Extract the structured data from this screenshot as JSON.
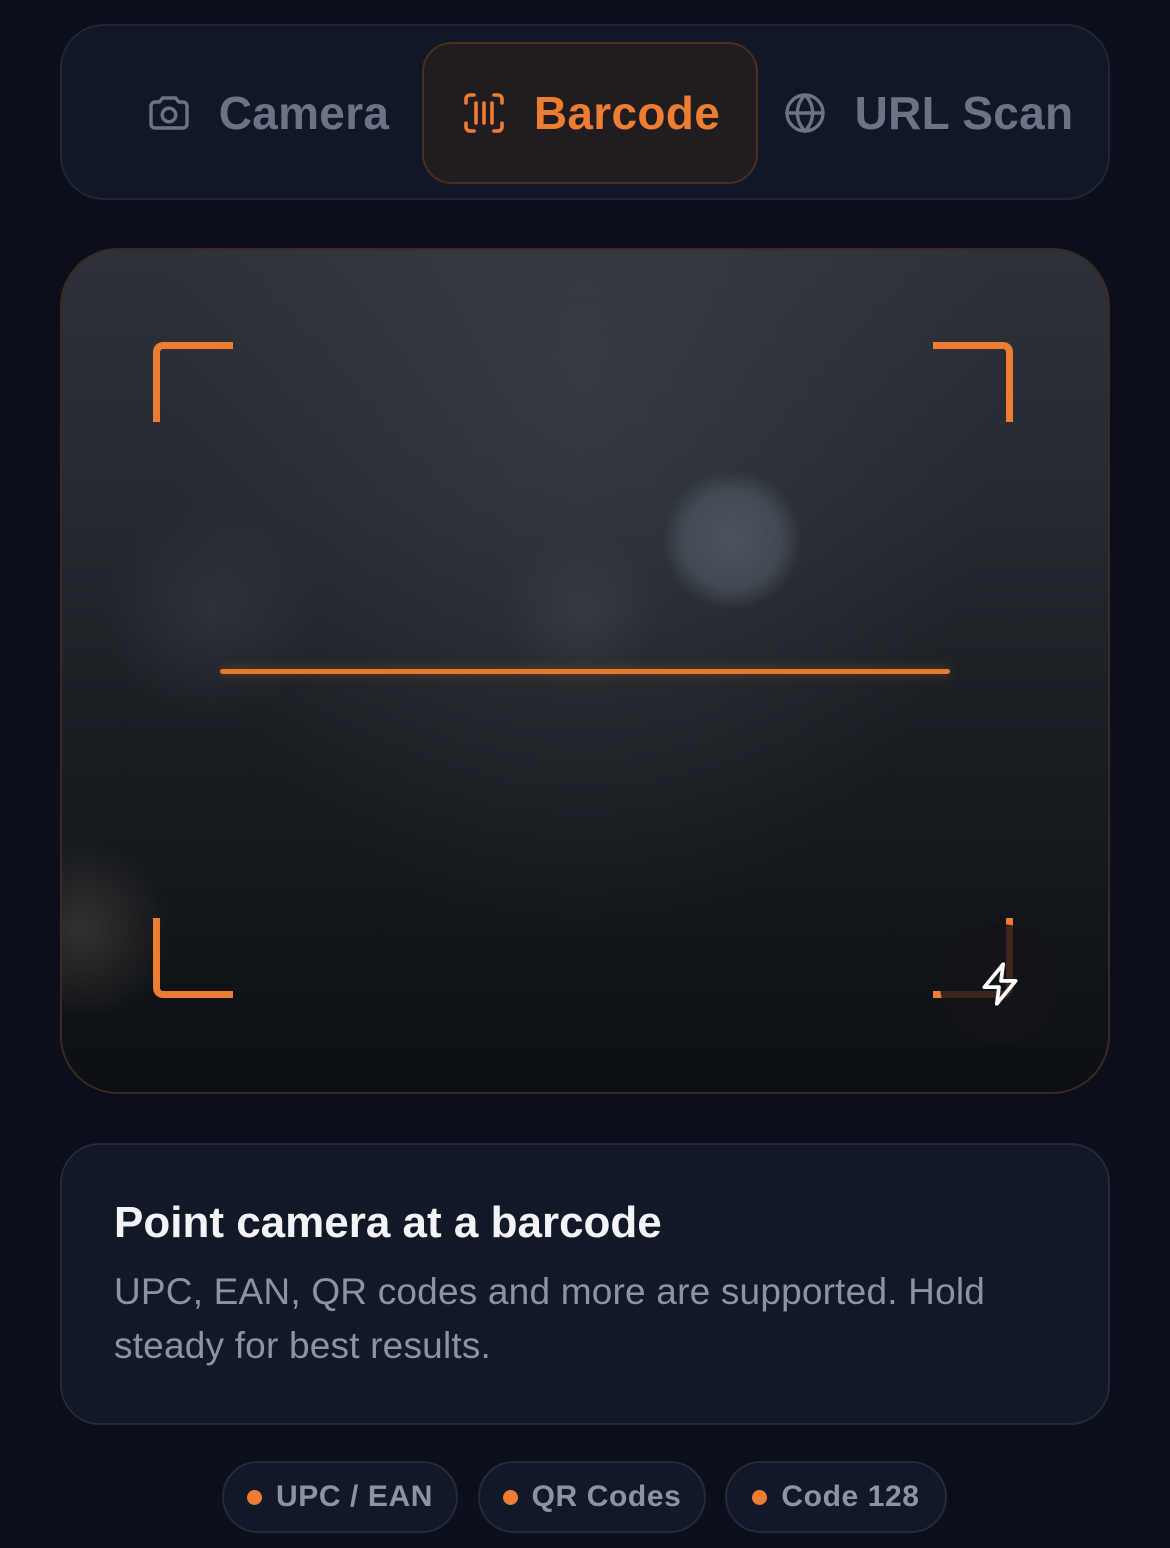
{
  "tabs": [
    {
      "label": "Camera",
      "icon": "camera-icon",
      "active": false
    },
    {
      "label": "Barcode",
      "icon": "barcode-scan-icon",
      "active": true
    },
    {
      "label": "URL Scan",
      "icon": "globe-icon",
      "active": false
    }
  ],
  "viewfinder": {
    "flash_icon": "lightning-bolt-icon"
  },
  "info": {
    "title": "Point camera at a barcode",
    "description": "UPC, EAN, QR codes and more are supported. Hold steady for best results."
  },
  "formats": [
    {
      "label": "UPC / EAN"
    },
    {
      "label": "QR Codes"
    },
    {
      "label": "Code 128"
    }
  ],
  "colors": {
    "accent": "#ee7d34",
    "background": "#0b0f19",
    "card": "#111827",
    "muted_text": "#8b93a5"
  }
}
